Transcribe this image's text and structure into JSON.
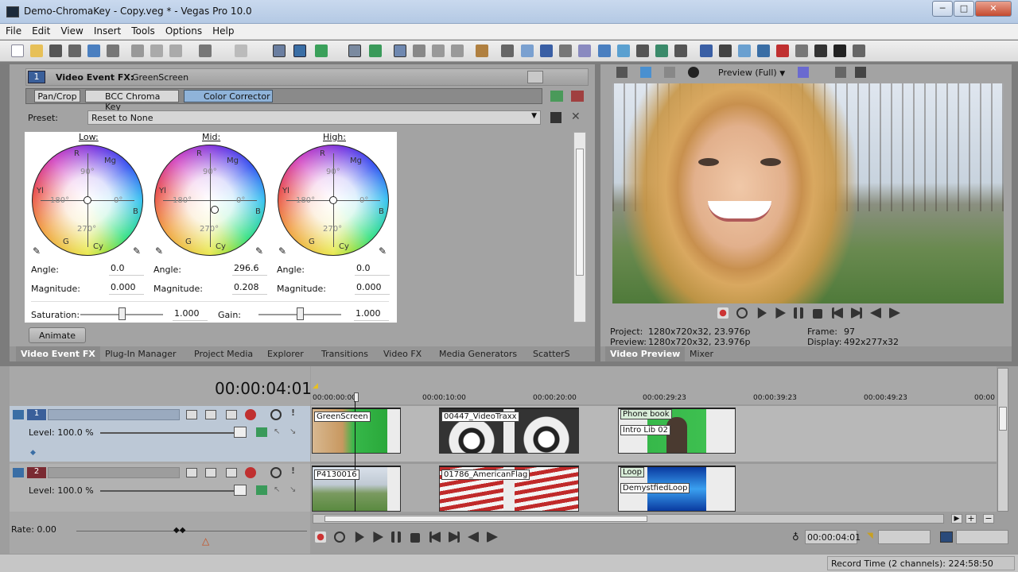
{
  "window": {
    "title": "Demo-ChromaKey - Copy.veg * - Vegas Pro 10.0",
    "minimize": "─",
    "maximize": "□",
    "close": "✕"
  },
  "menu": [
    "File",
    "Edit",
    "View",
    "Insert",
    "Tools",
    "Options",
    "Help"
  ],
  "fx": {
    "track_number": "1",
    "title": "Video Event FX:",
    "event": "GreenScreen",
    "chain": [
      "Pan/Crop",
      "BCC Chroma Key",
      "Color Corrector"
    ],
    "preset_label": "Preset:",
    "preset_value": "Reset to None"
  },
  "color_corrector": {
    "wheels": [
      {
        "name": "Low:",
        "angle": "0.0",
        "magnitude": "0.000"
      },
      {
        "name": "Mid:",
        "angle": "296.6",
        "magnitude": "0.208"
      },
      {
        "name": "High:",
        "angle": "0.0",
        "magnitude": "0.000"
      }
    ],
    "angle_label": "Angle:",
    "magnitude_label": "Magnitude:",
    "wheel_marks": {
      "r": "R",
      "mg": "Mg",
      "yl": "Yl",
      "b": "B",
      "g": "G",
      "cy": "Cy",
      "d90": "90°",
      "d180": "180°",
      "d0": "0°",
      "d270": "270°"
    },
    "saturation_label": "Saturation:",
    "saturation_value": "1.000",
    "saturation_level": 0.5,
    "gain_label": "Gain:",
    "gain_value": "1.000",
    "gain_level": 0.5
  },
  "animate_button": "Animate",
  "lower_tabs": [
    "Video Event FX",
    "Plug-In Manager",
    "Project Media",
    "Explorer",
    "Transitions",
    "Video FX",
    "Media Generators",
    "ScatterS"
  ],
  "preview": {
    "mode": "Preview (Full)",
    "project_label": "Project:",
    "project_value": "1280x720x32, 23.976p",
    "preview_label": "Preview:",
    "preview_value": "1280x720x32, 23.976p",
    "frame_label": "Frame:",
    "frame_value": "97",
    "display_label": "Display:",
    "display_value": "492x277x32",
    "tabs": [
      "Video Preview",
      "Mixer"
    ]
  },
  "timeline": {
    "timecode": "00:00:04:01",
    "ruler": [
      "00:00:00:00",
      "00:00:10:00",
      "00:00:20:00",
      "00:00:29:23",
      "00:00:39:23",
      "00:00:49:23",
      "00:00"
    ],
    "tracks": [
      {
        "number": "1",
        "level": "Level: 100.0 %",
        "clips": [
          "GreenScreen",
          "00447_VideoTraxx",
          "Phone book",
          "Intro Lib 02"
        ]
      },
      {
        "number": "2",
        "level": "Level: 100.0 %",
        "clips": [
          "P4130016",
          "01786_AmericanFlag",
          "Loop",
          "DemystfiedLoop"
        ]
      }
    ],
    "rate": "Rate: 0.00",
    "end_timecode": "00:00:04:01",
    "record_time": "Record Time (2 channels): 224:58:50"
  },
  "colors": {
    "accent": "#3a6ea5",
    "selected_tab": "#8fb3d9",
    "track1": "#3a5f9a",
    "track2": "#7a2a32"
  }
}
